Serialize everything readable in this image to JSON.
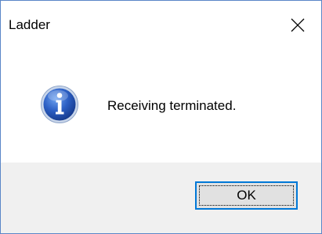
{
  "window": {
    "title": "Ladder",
    "close_icon": "close-icon",
    "accent_color": "#0078d7"
  },
  "message": {
    "icon": "info-icon",
    "text": "Receiving terminated."
  },
  "buttons": {
    "ok_label": "OK"
  }
}
